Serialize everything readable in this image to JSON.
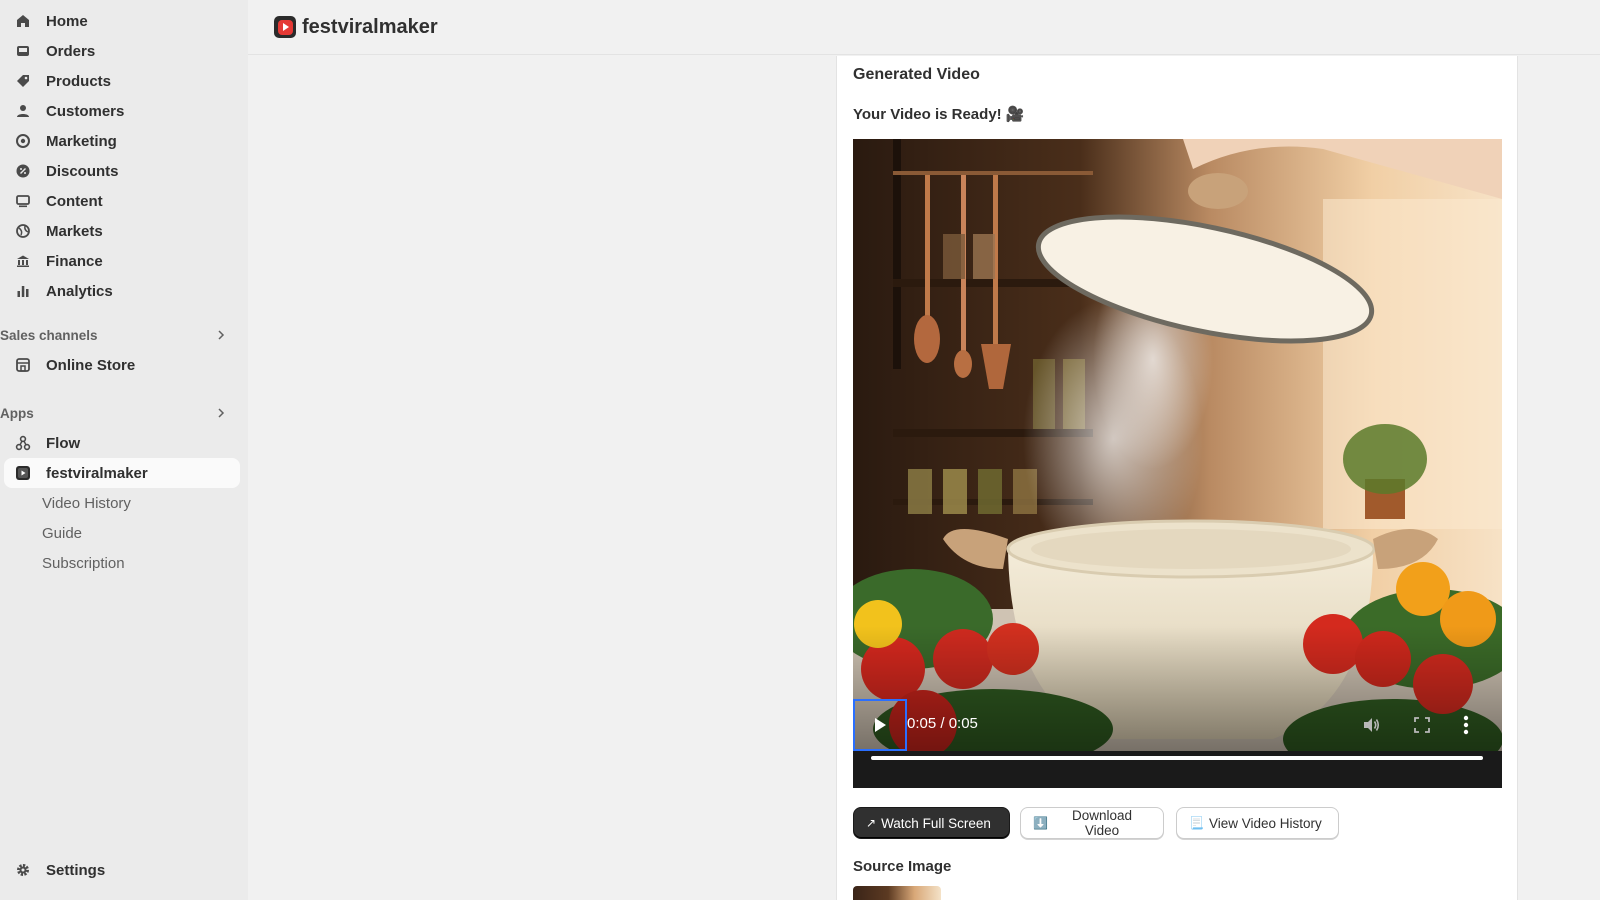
{
  "sidebar": {
    "nav": [
      {
        "label": "Home",
        "icon": "home-icon"
      },
      {
        "label": "Orders",
        "icon": "inbox-icon"
      },
      {
        "label": "Products",
        "icon": "tag-icon"
      },
      {
        "label": "Customers",
        "icon": "person-icon"
      },
      {
        "label": "Marketing",
        "icon": "target-icon"
      },
      {
        "label": "Discounts",
        "icon": "discount-icon"
      },
      {
        "label": "Content",
        "icon": "content-icon"
      },
      {
        "label": "Markets",
        "icon": "globe-icon"
      },
      {
        "label": "Finance",
        "icon": "bank-icon"
      },
      {
        "label": "Analytics",
        "icon": "bar-chart-icon"
      }
    ],
    "sales_channels": {
      "heading": "Sales channels",
      "items": [
        {
          "label": "Online Store",
          "icon": "store-icon"
        }
      ]
    },
    "apps": {
      "heading": "Apps",
      "items": [
        {
          "label": "Flow",
          "icon": "flow-icon"
        },
        {
          "label": "festviralmaker",
          "icon": "app-icon",
          "active": true
        }
      ],
      "subitems": [
        "Video History",
        "Guide",
        "Subscription"
      ]
    },
    "settings": {
      "label": "Settings",
      "icon": "gear-icon"
    }
  },
  "header": {
    "app_name": "festviralmaker"
  },
  "main": {
    "card_title": "Generated Video",
    "ready_text": "Your Video is Ready! 🎥",
    "video": {
      "time": "0:05 / 0:05",
      "progress": 1.0
    },
    "buttons": {
      "watch": {
        "emoji": "↗",
        "label": "Watch Full Screen"
      },
      "download": {
        "emoji": "⬇️",
        "label": "Download Video"
      },
      "history": {
        "emoji": "📃",
        "label": "View Video History"
      }
    },
    "source_title": "Source Image"
  },
  "colors": {
    "accent_red": "#e53935",
    "active_focus": "#2a6fff"
  }
}
